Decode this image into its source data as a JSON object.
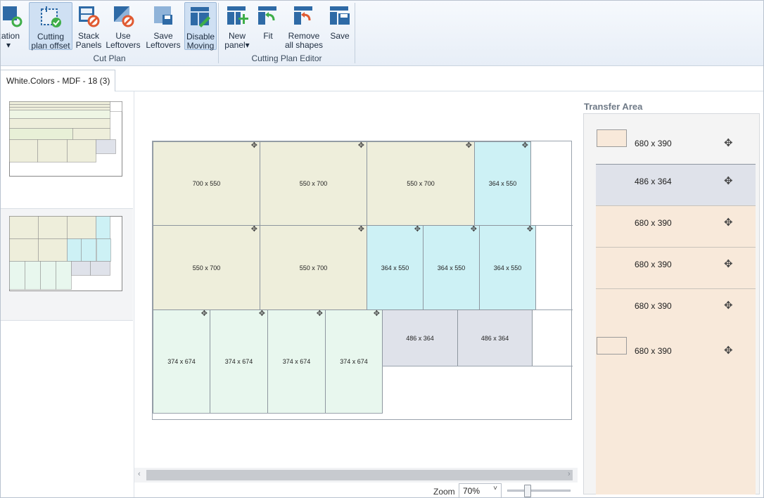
{
  "ribbon": {
    "buttons": [
      {
        "id": "optimization",
        "label": "zation",
        "sublabel": "▾",
        "icon": "optimization-icon"
      },
      {
        "id": "cutting_plan_offset",
        "label": "Cutting",
        "sublabel": "plan offset",
        "icon": "cutting-offset-icon",
        "active": true
      },
      {
        "id": "stack_panels",
        "label": "Stack",
        "sublabel": "Panels",
        "icon": "stack-panels-icon"
      },
      {
        "id": "use_leftovers",
        "label": "Use",
        "sublabel": "Leftovers",
        "icon": "use-leftovers-icon"
      },
      {
        "id": "save_leftovers",
        "label": "Save",
        "sublabel": "Leftovers",
        "icon": "save-leftovers-icon"
      },
      {
        "id": "disable_moving",
        "label": "Disable",
        "sublabel": "Moving",
        "icon": "disable-moving-icon",
        "active": true
      },
      {
        "id": "new_panel",
        "label": "New",
        "sublabel": "panel▾",
        "icon": "new-panel-icon"
      },
      {
        "id": "fit",
        "label": "Fit",
        "sublabel": "",
        "icon": "fit-icon"
      },
      {
        "id": "remove_all_shapes",
        "label": "Remove",
        "sublabel": "all shapes",
        "icon": "remove-shapes-icon"
      },
      {
        "id": "save",
        "label": "Save",
        "sublabel": "",
        "icon": "save-icon"
      }
    ],
    "groups": {
      "cut_plan": "Cut Plan",
      "cutting_plan_editor": "Cutting Plan Editor"
    }
  },
  "tab": {
    "label": "White.Colors - MDF - 18 (3)"
  },
  "sheet_parts": [
    {
      "label": "700 x 550",
      "color": "olive"
    },
    {
      "label": "550 x 700",
      "color": "olive"
    },
    {
      "label": "550 x 700",
      "color": "olive"
    },
    {
      "label": "364 x 550",
      "color": "cyan"
    },
    {
      "label": "550 x 700",
      "color": "olive"
    },
    {
      "label": "550 x 700",
      "color": "olive"
    },
    {
      "label": "364 x 550",
      "color": "cyan"
    },
    {
      "label": "364 x 550",
      "color": "cyan"
    },
    {
      "label": "364 x 550",
      "color": "cyan"
    },
    {
      "label": "374 x 674",
      "color": "mint"
    },
    {
      "label": "374 x 674",
      "color": "mint"
    },
    {
      "label": "374 x 674",
      "color": "mint"
    },
    {
      "label": "374 x 674",
      "color": "mint"
    },
    {
      "label": "486 x 364",
      "color": "gray"
    },
    {
      "label": "486 x 364",
      "color": "gray"
    }
  ],
  "move_glyph": "✥",
  "zoom": {
    "label": "Zoom",
    "value": "70%",
    "chevron": "˅",
    "slider_fraction": 0.3
  },
  "scroll": {
    "left_arrow": "‹",
    "right_arrow": "›"
  },
  "transfer_area": {
    "title": "Transfer Area",
    "items": [
      {
        "label": "680 x 390",
        "style": "plain",
        "swatch": "peach"
      },
      {
        "label": "486 x 364",
        "style": "blue"
      },
      {
        "label": "680 x 390",
        "style": "peach"
      },
      {
        "label": "680 x 390",
        "style": "peach"
      },
      {
        "label": "680 x 390",
        "style": "peach"
      },
      {
        "label": "680 x 390",
        "style": "peach",
        "swatch": "outline"
      }
    ]
  },
  "colors": {
    "olive": "#eeeedb",
    "cyan": "#cdf1f5",
    "mint": "#e8f7ee",
    "gray": "#dfe2ea",
    "peach": "#f8e9da",
    "ribbon_accent": "#2e7ab8",
    "icon_red": "#e05a32",
    "icon_green": "#3fae49"
  }
}
